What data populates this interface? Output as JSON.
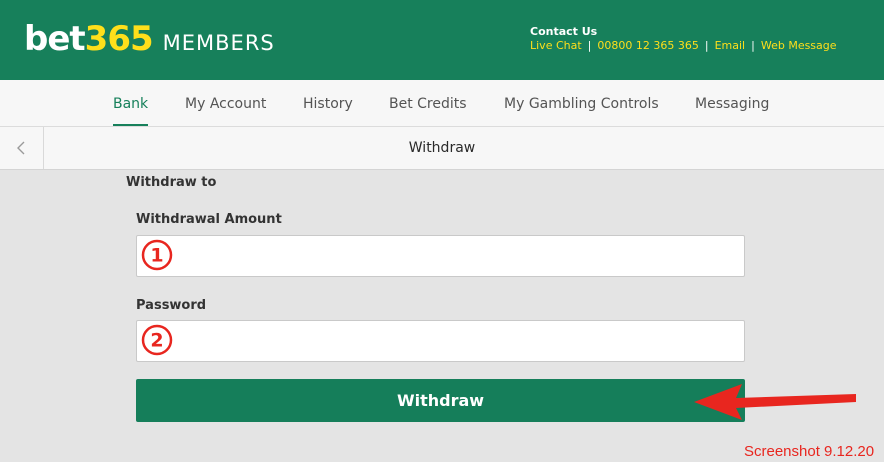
{
  "header": {
    "logo_bet": "bet",
    "logo_num": "365",
    "logo_members": "MEMBERS",
    "contact_title": "Contact Us",
    "contact_links": [
      "Live Chat",
      "00800 12 365 365",
      "Email",
      "Web Message"
    ],
    "background_color": "#17805b",
    "accent_color": "#ffdf1b"
  },
  "nav": {
    "items": [
      {
        "label": "Bank",
        "active": true
      },
      {
        "label": "My Account",
        "active": false
      },
      {
        "label": "History",
        "active": false
      },
      {
        "label": "Bet Credits",
        "active": false
      },
      {
        "label": "My Gambling Controls",
        "active": false
      },
      {
        "label": "Messaging",
        "active": false
      }
    ]
  },
  "titlebar": {
    "back_icon": "chevron-left-icon",
    "title": "Withdraw"
  },
  "form": {
    "section_label": "Withdraw to",
    "amount_label": "Withdrawal Amount",
    "amount_value": "",
    "amount_marker": "①",
    "password_label": "Password",
    "password_value": "",
    "password_marker": "②",
    "submit_label": "Withdraw",
    "button_color": "#157e5a"
  },
  "annotation": {
    "arrow_icon": "red-arrow-left-icon",
    "note": "Screenshot 9.12.20",
    "color": "#e8261f"
  }
}
